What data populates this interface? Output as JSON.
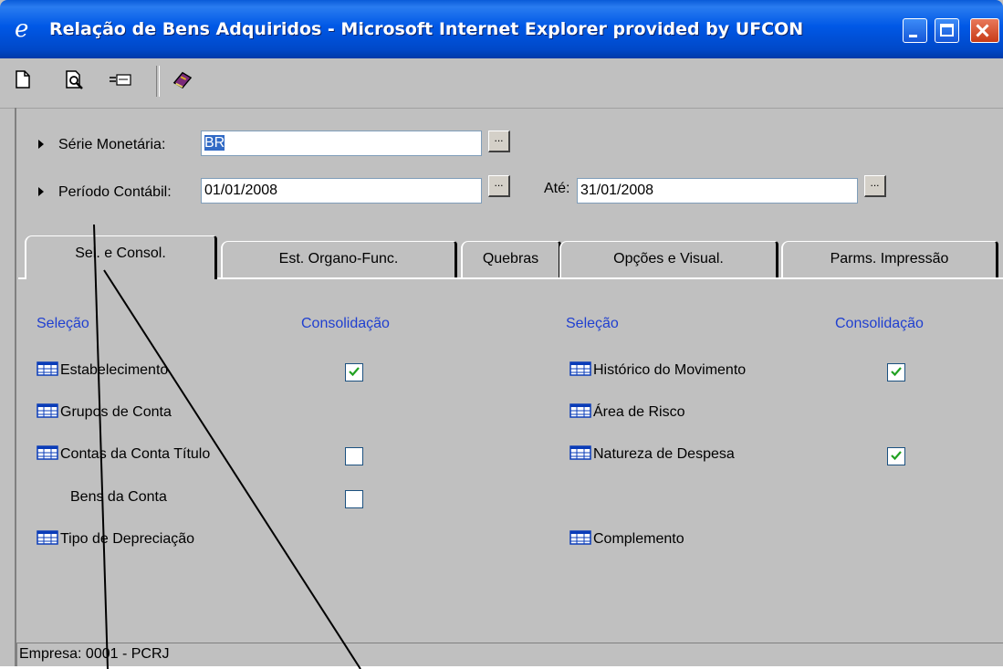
{
  "window": {
    "title": "Relação de Bens Adquiridos - Microsoft Internet Explorer provided by UFCON"
  },
  "toolbar": {
    "icons": [
      "new-document-icon",
      "print-preview-icon",
      "export-icon",
      "help-book-icon"
    ]
  },
  "form": {
    "serie": {
      "label": "Série Monetária:",
      "value": "BR"
    },
    "periodo": {
      "label": "Período Contábil:",
      "value": "01/01/2008"
    },
    "ate": {
      "label": "Até:",
      "value": "31/01/2008"
    },
    "ellipsis_label": "..."
  },
  "tabs": [
    {
      "label": "Sel. e Consol.",
      "active": true
    },
    {
      "label": "Est. Organo-Func.",
      "active": false
    },
    {
      "label": "Quebras",
      "active": false
    },
    {
      "label": "Opções e Visual.",
      "active": false
    },
    {
      "label": "Parms. Impressão",
      "active": false
    }
  ],
  "panel": {
    "left": {
      "selecao_header": "Seleção",
      "consolidacao_header": "Consolidação",
      "items": [
        {
          "label": "Estabelecimento",
          "has_icon": true,
          "checkbox": "checked"
        },
        {
          "label": "Grupos de Conta",
          "has_icon": true,
          "checkbox": "none"
        },
        {
          "label": "Contas da Conta Título",
          "has_icon": true,
          "checkbox": "unchecked"
        },
        {
          "label": "Bens da Conta",
          "has_icon": false,
          "checkbox": "unchecked"
        },
        {
          "label": "Tipo de Depreciação",
          "has_icon": true,
          "checkbox": "none"
        }
      ]
    },
    "right": {
      "selecao_header": "Seleção",
      "consolidacao_header": "Consolidação",
      "items": [
        {
          "label": "Histórico do Movimento",
          "has_icon": true,
          "checkbox": "checked"
        },
        {
          "label": "Área de Risco",
          "has_icon": true,
          "checkbox": "none"
        },
        {
          "label": "Natureza de Despesa",
          "has_icon": true,
          "checkbox": "checked"
        },
        {
          "label": "Complemento",
          "has_icon": true,
          "checkbox": "none"
        }
      ]
    }
  },
  "status": {
    "text": "Empresa: 0001 - PCRJ"
  },
  "colors": {
    "titlebar": "#0058e6",
    "header_text": "#1f3fd0",
    "window_bg": "#c0c0c0"
  }
}
